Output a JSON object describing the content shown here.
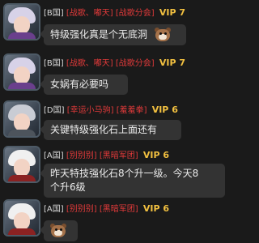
{
  "messages": [
    {
      "server": "[B国]",
      "guild1": "[战歌、嘟天]",
      "guild2": "[战歌分会]",
      "vip": "VIP 7",
      "text": "特级强化真是个无底洞",
      "has_emoji": true,
      "emoji_icon": "bear-emoji-icon",
      "avatar_style": "purple"
    },
    {
      "server": "[B国]",
      "guild1": "[战歌、嘟天]",
      "guild2": "[战歌分会]",
      "vip": "VIP 7",
      "text": "女娲有必要吗",
      "has_emoji": false,
      "avatar_style": "purple"
    },
    {
      "server": "[D国]",
      "guild1": "[幸运小马驹]",
      "guild2": "[羞羞拳]",
      "vip": "VIP 6",
      "text": "关键特级强化石上面还有",
      "has_emoji": false,
      "avatar_style": "gray"
    },
    {
      "server": "[A国]",
      "guild1": "[别别别]",
      "guild2": "[黑暗军团]",
      "vip": "VIP 6",
      "text_line1": "昨天特技强化石8个升一级。今天8",
      "text_line2": "个升6级",
      "has_emoji": false,
      "avatar_style": "white"
    },
    {
      "server": "[A国]",
      "guild1": "[别别别]",
      "guild2": "[黑暗军团]",
      "vip": "VIP 6",
      "text": "",
      "has_emoji": true,
      "emoji_icon": "bear-emoji-icon",
      "avatar_style": "white"
    }
  ],
  "colors": {
    "background": "#1a1a1a",
    "bubble": "#333333",
    "guild_red": "#e23a3a",
    "vip_gold": "#f2c040",
    "text": "#ececec"
  }
}
